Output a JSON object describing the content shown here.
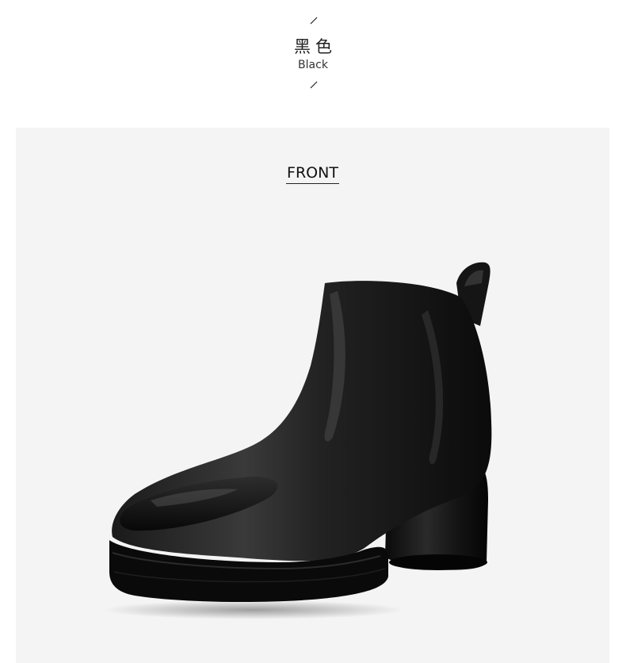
{
  "header": {
    "color_name_cn": "黑色",
    "color_name_en": "Black"
  },
  "panel": {
    "view_label": "FRONT",
    "background": "#f4f4f4"
  },
  "product": {
    "color": "#0e0e0e"
  }
}
